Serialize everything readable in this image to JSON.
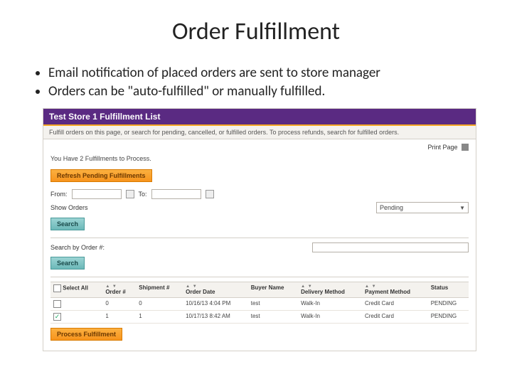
{
  "title": "Order Fulfillment",
  "bullets": [
    "Email notification of placed orders are sent to store manager",
    "Orders can be \"auto-fulfilled\" or manually fulfilled."
  ],
  "shot": {
    "header": "Test Store 1 Fulfillment List",
    "subheader": "Fulfill orders on this page, or search for pending, cancelled, or fulfilled orders. To process refunds, search for fulfilled orders.",
    "print_label": "Print Page",
    "notice": "You Have 2 Fulfillments to Process.",
    "refresh_btn": "Refresh Pending Fulfillments",
    "from_label": "From:",
    "to_label": "To:",
    "show_orders_label": "Show Orders",
    "status_select": "Pending",
    "search_btn": "Search",
    "search_order_label": "Search by Order #:",
    "process_btn": "Process Fulfillment",
    "columns": {
      "select": "Select All",
      "order_num": "Order #",
      "shipment_num": "Shipment #",
      "order_date": "Order Date",
      "buyer": "Buyer Name",
      "delivery": "Delivery Method",
      "payment": "Payment Method",
      "status": "Status"
    },
    "rows": [
      {
        "checked": false,
        "order_num": "0",
        "shipment_num": "0",
        "order_date": "10/16/13 4:04 PM",
        "buyer": "test",
        "delivery": "Walk-In",
        "payment": "Credit Card",
        "status": "PENDING"
      },
      {
        "checked": true,
        "order_num": "1",
        "shipment_num": "1",
        "order_date": "10/17/13 8:42 AM",
        "buyer": "test",
        "delivery": "Walk-In",
        "payment": "Credit Card",
        "status": "PENDING"
      }
    ]
  }
}
